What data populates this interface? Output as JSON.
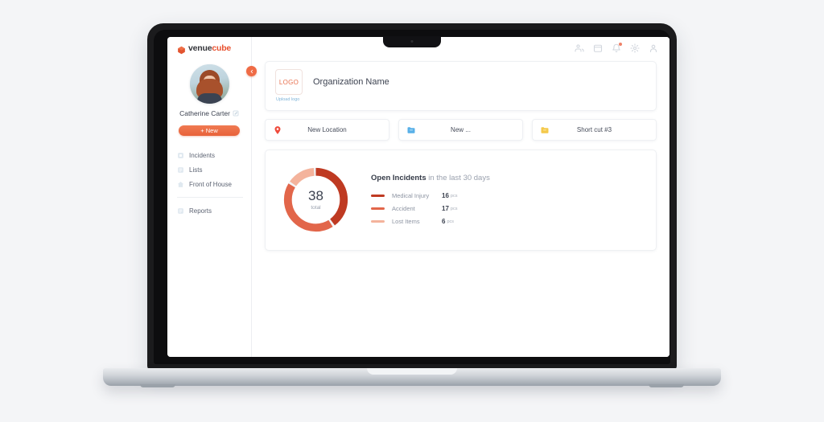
{
  "brand": {
    "part1": "venue",
    "part2": "cube"
  },
  "topbar": {
    "icons": [
      {
        "name": "users-icon"
      },
      {
        "name": "calendar-icon"
      },
      {
        "name": "bell-icon"
      },
      {
        "name": "gear-icon"
      },
      {
        "name": "profile-icon"
      }
    ]
  },
  "sidebar": {
    "collapse_icon": "chevron-left-icon",
    "user_name": "Catherine Carter",
    "edit_icon": "edit-pencil-icon",
    "new_button": "+ New",
    "items": [
      {
        "label": "Incidents",
        "icon": "incidents-icon"
      },
      {
        "label": "Lists",
        "icon": "list-icon"
      },
      {
        "label": "Front of House",
        "icon": "home-icon"
      }
    ],
    "secondary_items": [
      {
        "label": "Reports",
        "icon": "report-icon"
      }
    ]
  },
  "main": {
    "logo_placeholder": "LOGO",
    "upload_logo": "Upload logo",
    "org_name": "Organization Name",
    "shortcuts": [
      {
        "label": "New Location",
        "icon": "map-pin-icon",
        "color": "#ef4b3c"
      },
      {
        "label": "New ...",
        "icon": "folder-icon",
        "color": "#58b0e8"
      },
      {
        "label": "Short cut #3",
        "icon": "folder-icon",
        "color": "#f4c94a"
      }
    ]
  },
  "chart_data": {
    "type": "pie",
    "title_bold": "Open Incidents",
    "title_rest": " in the last 30 days",
    "center_value": "38",
    "center_label": "total",
    "unit": "pcs",
    "categories": [
      "Medical Injury",
      "Accident",
      "Lost Items"
    ],
    "values": [
      16,
      17,
      6
    ],
    "total": 38,
    "colors": [
      "#bf3a22",
      "#e2664a",
      "#f4b39c"
    ],
    "legend_position": "right",
    "donut": true
  }
}
